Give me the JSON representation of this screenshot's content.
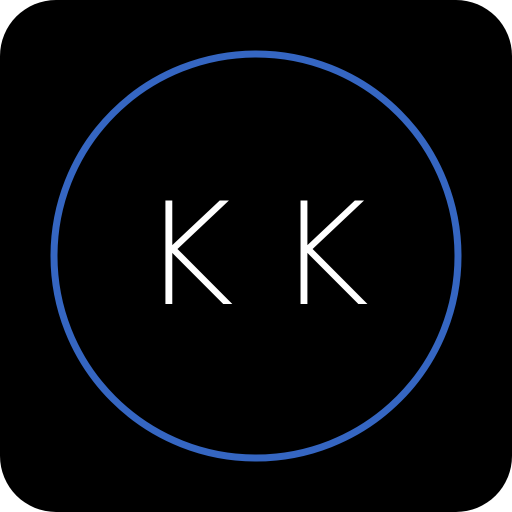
{
  "icon": {
    "monogram": "KK",
    "background_color": "#000000",
    "ring_color": "#3566c2",
    "text_color": "#ffffff"
  }
}
